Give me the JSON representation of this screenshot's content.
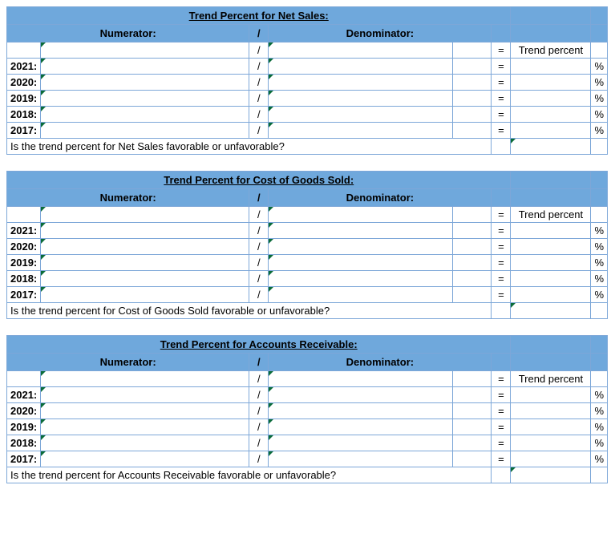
{
  "common": {
    "numerator_label": "Numerator:",
    "denominator_label": "Denominator:",
    "slash": "/",
    "equals": "=",
    "percent": "%",
    "trend_percent_label": "Trend percent"
  },
  "years": [
    "2021:",
    "2020:",
    "2019:",
    "2018:",
    "2017:"
  ],
  "sections": [
    {
      "title": "Trend Percent for Net Sales:",
      "question": "Is the trend percent for Net Sales favorable or unfavorable?"
    },
    {
      "title": "Trend Percent for Cost of Goods Sold:",
      "question": "Is the trend percent for Cost of Goods Sold favorable or unfavorable?"
    },
    {
      "title": "Trend Percent for Accounts Receivable:",
      "question": "Is the trend percent for Accounts Receivable favorable or unfavorable?"
    }
  ]
}
